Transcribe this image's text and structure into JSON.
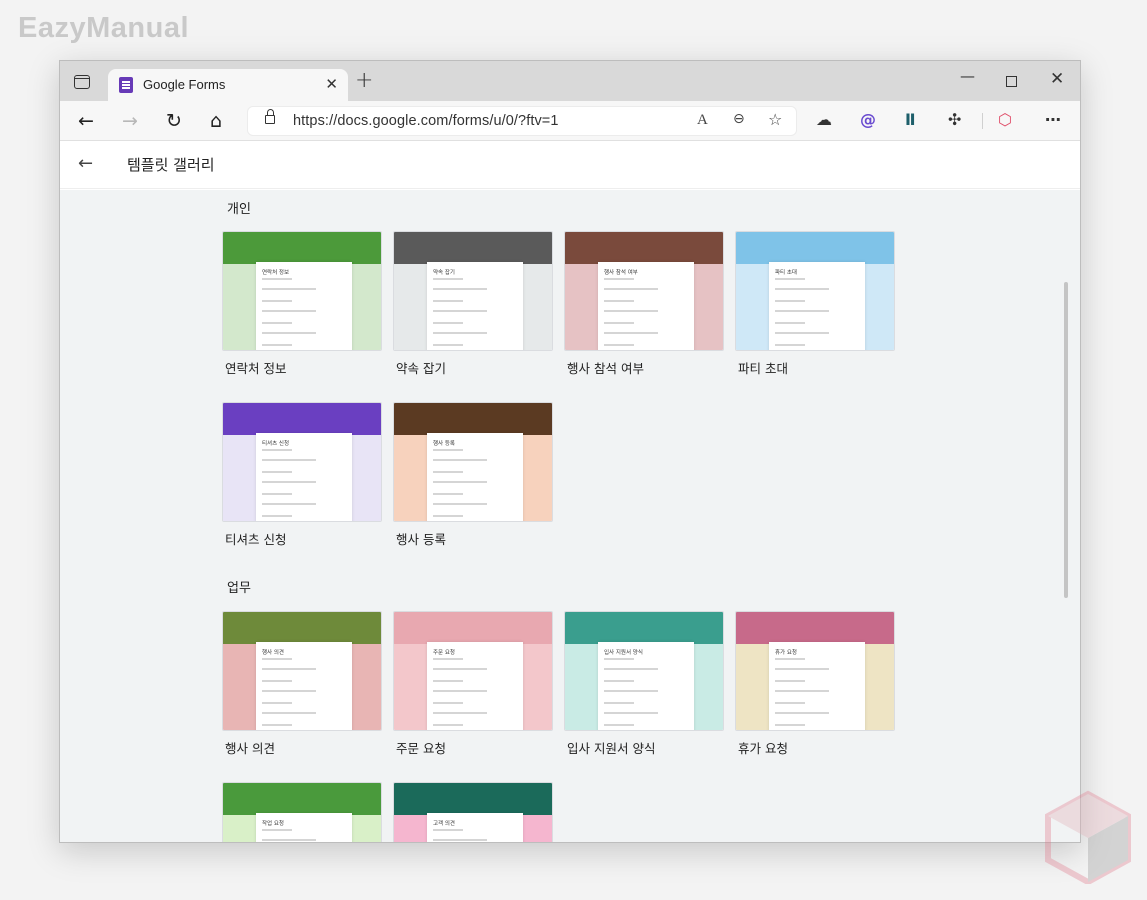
{
  "watermark": "EazyManual",
  "browser": {
    "tab_title": "Google Forms",
    "tab_close": "✕",
    "new_tab": "+",
    "window_controls": {
      "minimize": "—",
      "close": "✕"
    },
    "nav": {
      "back": "←",
      "forward": "→",
      "refresh": "↻",
      "home": "⌂"
    },
    "address": "https://docs.google.com/forms/u/0/?ftv=1",
    "address_icons": {
      "read_aloud": "A",
      "zoom": "⊖",
      "favorite": "☆"
    },
    "extensions": {
      "cloud": "☁",
      "purple_ext": "@",
      "bars_ext": "Ⅱ",
      "puzzle": "✣",
      "hex_ext": "⬡",
      "more": "⋯"
    },
    "icon_names": [
      "tab-actions-icon",
      "forms-favicon-icon",
      "lock-icon",
      "read-aloud-icon",
      "zoom-icon",
      "favorite-icon",
      "cloud-icon",
      "puzzle-icon",
      "more-icon"
    ]
  },
  "header": {
    "back": "←",
    "title": "템플릿 갤러리"
  },
  "sections": [
    {
      "label": "개인",
      "templates": [
        {
          "label": "연락처 정보",
          "sheet": "연락처 정보",
          "top": "#4c9a3a",
          "bottom": "#d3e8cc"
        },
        {
          "label": "약속 잡기",
          "sheet": "약속 잡기",
          "top": "#5a5a5a",
          "bottom": "#e6e9ea"
        },
        {
          "label": "행사 참석 여부",
          "sheet": "행사 참석 여부",
          "top": "#7a4a3c",
          "bottom": "#e6c2c4"
        },
        {
          "label": "파티 초대",
          "sheet": "파티 초대",
          "top": "#7fc3e8",
          "bottom": "#cfe8f7"
        }
      ]
    },
    {
      "label": "",
      "templates": [
        {
          "label": "티셔츠 신청",
          "sheet": "티셔츠 신청",
          "top": "#6a3fc1",
          "bottom": "#e8e4f6"
        },
        {
          "label": "행사 등록",
          "sheet": "행사 등록",
          "top": "#5b3a22",
          "bottom": "#f7d2bd"
        }
      ]
    },
    {
      "label": "업무",
      "templates": [
        {
          "label": "행사 의견",
          "sheet": "행사 의견",
          "top": "#6e8a3a",
          "bottom": "#e8b5b4"
        },
        {
          "label": "주문 요청",
          "sheet": "주문 요청",
          "top": "#e8a8b0",
          "bottom": "#f3c7cb"
        },
        {
          "label": "입사 지원서 양식",
          "sheet": "입사 지원서 양식",
          "top": "#3a9e8e",
          "bottom": "#c9ebe5"
        },
        {
          "label": "휴가 요청",
          "sheet": "휴가 요청",
          "top": "#c76a8a",
          "bottom": "#eee4c4"
        }
      ]
    },
    {
      "label": "",
      "templates": [
        {
          "label": "",
          "sheet": "작업 요청",
          "top": "#4a9a3c",
          "bottom": "#d9f0c8"
        },
        {
          "label": "",
          "sheet": "고객 의견",
          "top": "#1b6a5a",
          "bottom": "#f5b6cf"
        }
      ]
    }
  ]
}
